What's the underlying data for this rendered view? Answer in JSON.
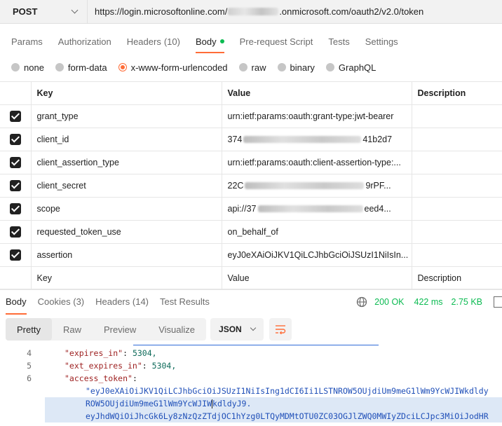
{
  "request": {
    "method": "POST",
    "url_prefix": "https://login.microsoftonline.com/",
    "url_suffix": ".onmicrosoft.com/oauth2/v2.0/token"
  },
  "request_tabs": [
    {
      "label": "Params"
    },
    {
      "label": "Authorization"
    },
    {
      "label": "Headers",
      "count": "(10)"
    },
    {
      "label": "Body"
    },
    {
      "label": "Pre-request Script"
    },
    {
      "label": "Tests"
    },
    {
      "label": "Settings"
    }
  ],
  "body_types": [
    "none",
    "form-data",
    "x-www-form-urlencoded",
    "raw",
    "binary",
    "GraphQL"
  ],
  "selected_body_type": "x-www-form-urlencoded",
  "table": {
    "headers": {
      "key": "Key",
      "value": "Value",
      "description": "Description"
    },
    "rows": [
      {
        "key": "grant_type",
        "value": "urn:ietf:params:oauth:grant-type:jwt-bearer",
        "checked": true
      },
      {
        "key": "client_id",
        "value_start": "374",
        "value_end": "41b2d7",
        "checked": true
      },
      {
        "key": "client_assertion_type",
        "value": "urn:ietf:params:oauth:client-assertion-type:...",
        "checked": true
      },
      {
        "key": "client_secret",
        "value_start": "22C",
        "value_end": "9rPF...",
        "checked": true
      },
      {
        "key": "scope",
        "value_start": "api://37",
        "value_end": "eed4...",
        "checked": true
      },
      {
        "key": "requested_token_use",
        "value": "on_behalf_of",
        "checked": true
      },
      {
        "key": "assertion",
        "value": "eyJ0eXAiOiJKV1QiLCJhbGciOiJSUzI1NiIsIn...",
        "checked": true
      }
    ],
    "placeholder": {
      "key": "Key",
      "value": "Value",
      "description": "Description"
    }
  },
  "response_tabs": [
    {
      "label": "Body"
    },
    {
      "label": "Cookies",
      "count": "(3)"
    },
    {
      "label": "Headers",
      "count": "(14)"
    },
    {
      "label": "Test Results"
    }
  ],
  "response_meta": {
    "status": "200 OK",
    "time": "422 ms",
    "size": "2.75 KB"
  },
  "viewer": {
    "modes": [
      "Pretty",
      "Raw",
      "Preview",
      "Visualize"
    ],
    "active_mode": "Pretty",
    "format": "JSON"
  },
  "code": {
    "line4": {
      "num": "4",
      "key": "\"expires_in\"",
      "value": "5304,"
    },
    "line5": {
      "num": "5",
      "key": "\"ext_expires_in\"",
      "value": "5304,"
    },
    "line6": {
      "num": "6",
      "key": "\"access_token\"",
      "colon": ":"
    },
    "wrap1": "\"eyJ0eXAiOiJKV1QiLCJhbGciOiJSUzI1NiIsIng1dCI6Ii1LSTNROW5OUjdiUm9meG1lWm9YcWJIWkdldy",
    "wrap2_a": "ROW5OUjdiUm9meG1lWm9YcWJIW",
    "wrap2_b": "kdldyJ9.",
    "wrap3": "eyJhdWQiOiJhcGk6Ly8zNzQzZTdjOC1hYzg0LTQyMDMtOTU0ZC03OGJlZWQ0MWIyZDciLCJpc3MiOiJodHR"
  },
  "colors": {
    "accent": "#ff6c37",
    "success": "#0cbb52"
  }
}
